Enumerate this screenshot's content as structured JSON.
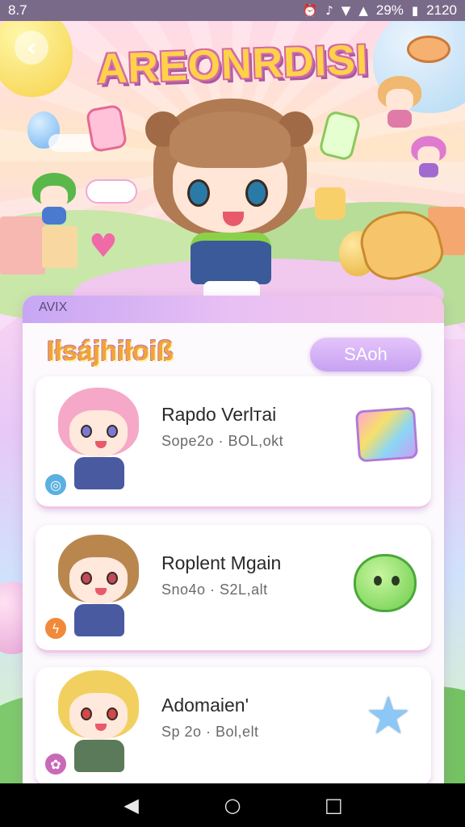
{
  "status_bar": {
    "time": "8.7",
    "battery": "29%",
    "clock": "2120"
  },
  "header": {
    "back_icon": "chevron-left-icon",
    "title": "AREONRDISI"
  },
  "panel": {
    "header_label": "AVIX",
    "section_title": "Iłsájhiłoiß",
    "search_button_label": "SAoh"
  },
  "cards": [
    {
      "name": "Rapdo Verlтai",
      "meta": "Sope2o · BOL,okt",
      "hair_color": "#f6a8c8",
      "badge_color": "#5ab0e0",
      "badge_icon": "ring-icon",
      "item": "gem-icon"
    },
    {
      "name": "Roplent Mgain",
      "meta": "Sno4o · S2L,alt",
      "hair_color": "#b9874e",
      "badge_color": "#f08a3a",
      "badge_icon": "lightning-icon",
      "item": "frog-icon"
    },
    {
      "name": "Adomaien'",
      "meta": "Sp 2o · Bol,elt",
      "hair_color": "#f2d060",
      "badge_color": "#c86ab8",
      "badge_icon": "flower-icon",
      "item": "star-icon"
    }
  ],
  "nav": {
    "back": "◀",
    "home": "○",
    "recent": "□"
  },
  "colors": {
    "accent": "#c7a1f2",
    "title_fill": "#ffd24a",
    "title_outline": "#d46aa8"
  }
}
